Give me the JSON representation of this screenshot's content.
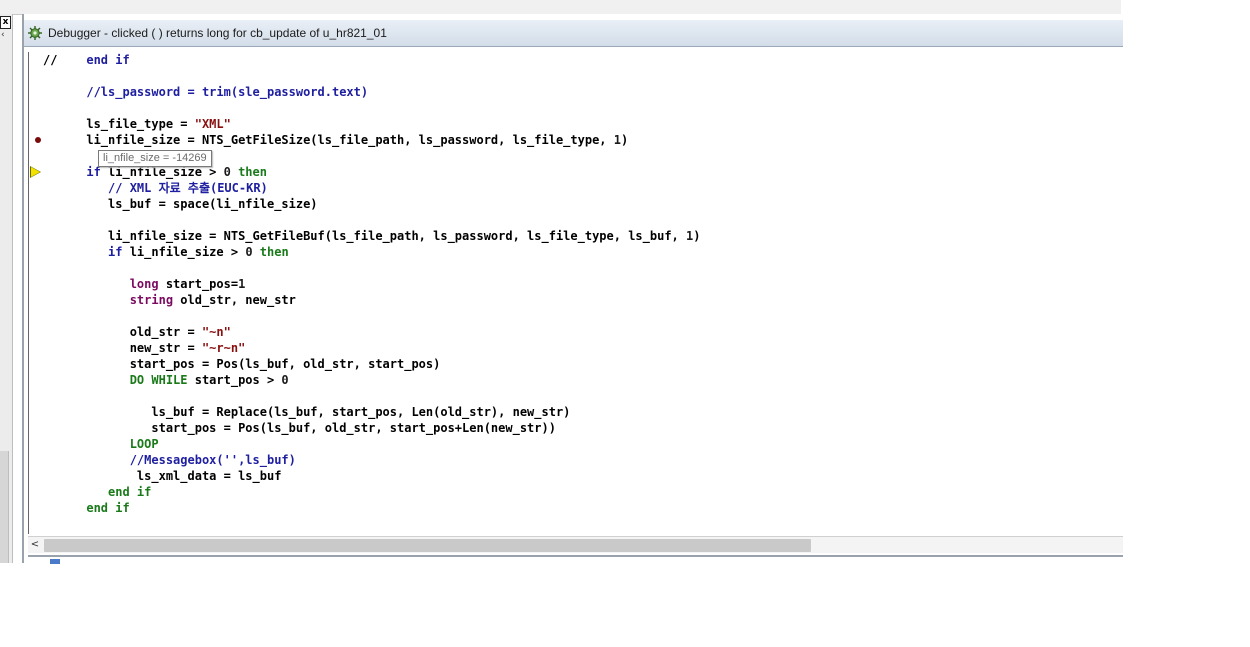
{
  "window": {
    "title": "Debugger - clicked ( )  returns long for cb_update of u_hr821_01",
    "icon": "bug-gear-icon"
  },
  "tooltip": {
    "text": "li_nfile_size = -14269"
  },
  "left_frame": {
    "close_glyph": "x",
    "arrow_glyph": "‹"
  },
  "scrollbar": {
    "left_arrow": "<"
  },
  "code_lines": [
    {
      "marker": "",
      "segs": [
        [
          "",
          "//    "
        ],
        [
          "kw",
          "end if"
        ]
      ]
    },
    {
      "marker": "",
      "segs": []
    },
    {
      "marker": "",
      "segs": [
        [
          "kw",
          "      //ls_password = trim(sle_password.text)"
        ]
      ]
    },
    {
      "marker": "",
      "segs": []
    },
    {
      "marker": "",
      "segs": [
        [
          "",
          "      ls_file_type = "
        ],
        [
          "str",
          "\"XML\""
        ]
      ]
    },
    {
      "marker": "breakpoint",
      "segs": [
        [
          "",
          "      li_nfile_size = NTS_GetFileSize(ls_file_path, ls_password, ls_file_type, "
        ],
        [
          "num",
          "1"
        ],
        [
          "",
          ")"
        ]
      ]
    },
    {
      "marker": "",
      "segs": []
    },
    {
      "marker": "current",
      "segs": [
        [
          "kw",
          "      if"
        ],
        [
          "",
          " li_nfile_size > "
        ],
        [
          "num",
          "0"
        ],
        [
          "kw2",
          " then"
        ]
      ]
    },
    {
      "marker": "",
      "segs": [
        [
          "kw",
          "         // XML 자료 추출(EUC-KR)"
        ]
      ]
    },
    {
      "marker": "",
      "segs": [
        [
          "",
          "         ls_buf = space(li_nfile_size)"
        ]
      ]
    },
    {
      "marker": "",
      "segs": []
    },
    {
      "marker": "",
      "segs": [
        [
          "",
          "         li_nfile_size = NTS_GetFileBuf(ls_file_path, ls_password, ls_file_type, ls_buf, "
        ],
        [
          "num",
          "1"
        ],
        [
          "",
          ")"
        ]
      ]
    },
    {
      "marker": "",
      "segs": [
        [
          "kw",
          "         if"
        ],
        [
          "",
          " li_nfile_size > "
        ],
        [
          "num",
          "0"
        ],
        [
          "kw2",
          " then"
        ]
      ]
    },
    {
      "marker": "",
      "segs": []
    },
    {
      "marker": "",
      "segs": [
        [
          "type",
          "            long"
        ],
        [
          "",
          " start_pos="
        ],
        [
          "num",
          "1"
        ]
      ]
    },
    {
      "marker": "",
      "segs": [
        [
          "type",
          "            string"
        ],
        [
          "",
          " old_str, new_str"
        ]
      ]
    },
    {
      "marker": "",
      "segs": []
    },
    {
      "marker": "",
      "segs": [
        [
          "",
          "            old_str = "
        ],
        [
          "str",
          "\"~n\""
        ]
      ]
    },
    {
      "marker": "",
      "segs": [
        [
          "",
          "            new_str = "
        ],
        [
          "str",
          "\"~r~n\""
        ]
      ]
    },
    {
      "marker": "",
      "segs": [
        [
          "",
          "            start_pos = Pos(ls_buf, old_str, start_pos)"
        ]
      ]
    },
    {
      "marker": "",
      "segs": [
        [
          "kw2",
          "            DO WHILE"
        ],
        [
          "",
          " start_pos > "
        ],
        [
          "num",
          "0"
        ]
      ]
    },
    {
      "marker": "",
      "segs": []
    },
    {
      "marker": "",
      "segs": [
        [
          "",
          "               ls_buf = Replace(ls_buf, start_pos, Len(old_str), new_str)"
        ]
      ]
    },
    {
      "marker": "",
      "segs": [
        [
          "",
          "               start_pos = Pos(ls_buf, old_str, start_pos+Len(new_str))"
        ]
      ]
    },
    {
      "marker": "",
      "segs": [
        [
          "kw2",
          "            LOOP"
        ]
      ]
    },
    {
      "marker": "",
      "segs": [
        [
          "kw",
          "            //Messagebox('',ls_buf)"
        ]
      ]
    },
    {
      "marker": "",
      "segs": [
        [
          "",
          "             ls_xml_data = ls_buf"
        ]
      ]
    },
    {
      "marker": "",
      "segs": [
        [
          "kw2",
          "         end if"
        ]
      ]
    },
    {
      "marker": "",
      "segs": [
        [
          "kw2",
          "      end if"
        ]
      ]
    }
  ]
}
